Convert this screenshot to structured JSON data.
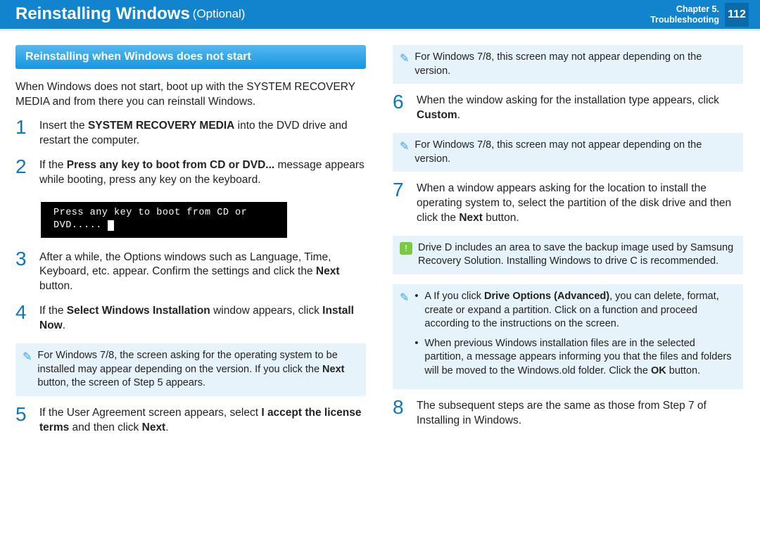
{
  "header": {
    "title": "Reinstalling Windows",
    "subtitle": "(Optional)",
    "chapter_line1": "Chapter 5.",
    "chapter_line2": "Troubleshooting",
    "page_num": "112"
  },
  "left": {
    "section_title": "Reinstalling when Windows does not start",
    "intro": "When Windows does not start, boot up with the SYSTEM RECOVERY MEDIA and from there you can reinstall Windows.",
    "steps": {
      "1": {
        "pre": "Insert the ",
        "bold1": "SYSTEM RECOVERY MEDIA",
        "post": " into the DVD drive and restart the computer."
      },
      "2": {
        "pre": "If the ",
        "bold1": "Press any key to boot from CD or DVD...",
        "post": " message appears while booting, press any key on the keyboard."
      },
      "boot_msg": "Press any key to boot from CD or DVD.....",
      "3": {
        "text_a": "After a while, the Options windows such as Language, Time, Keyboard, etc. appear. Confirm the settings and click the ",
        "bold": "Next",
        "text_b": " button."
      },
      "4": {
        "text_a": "If the ",
        "bold1": "Select Windows Installation",
        "text_b": " window appears, click ",
        "bold2": "Install Now",
        "text_c": "."
      },
      "note4": {
        "a": "For Windows 7/8, the screen asking for the operating system to be installed may appear depending on the version. If you click the ",
        "b": "Next",
        "c": " button, the screen of Step 5 appears."
      },
      "5": {
        "text_a": "If the User Agreement screen appears, select ",
        "bold1": "I accept the license terms",
        "text_b": " and then click ",
        "bold2": "Next",
        "text_c": "."
      }
    }
  },
  "right": {
    "note_top": "For Windows 7/8, this screen may not appear depending on the version.",
    "steps": {
      "6": {
        "text_a": "When the window asking for the installation type appears, click ",
        "bold": "Custom",
        "text_b": "."
      },
      "note6": "For Windows 7/8, this screen may not appear depending on the version.",
      "7": {
        "text_a": "When a window appears asking for the location to install the operating system to, select the partition of the disk drive and then click the ",
        "bold": "Next",
        "text_b": " button."
      },
      "warn7": "Drive D includes an area to save the backup image used by Samsung Recovery Solution. Installing Windows to drive C is recommended.",
      "note7_list": {
        "li1_a": "A If you click ",
        "li1_bold": "Drive Options (Advanced)",
        "li1_b": ", you can delete, format, create or expand a partition. Click on a function and proceed according to the instructions on the screen.",
        "li2_a": "When previous Windows installation files are in the selected partition, a message appears informing you that the files and folders will be moved to the Windows.old folder. Click the ",
        "li2_bold": "OK",
        "li2_b": " button."
      },
      "8": {
        "text": "The subsequent steps are the same as those from Step 7 of Installing in Windows."
      }
    }
  }
}
